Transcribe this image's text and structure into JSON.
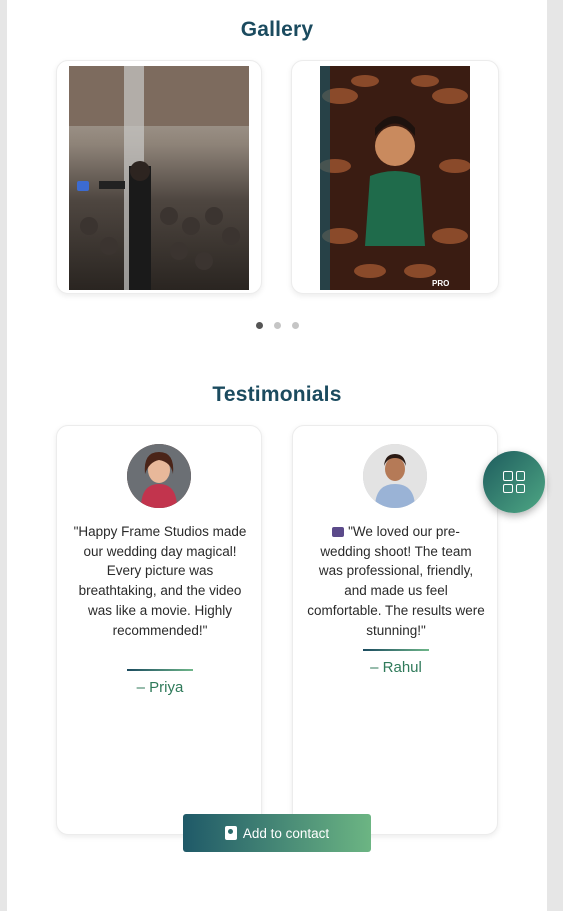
{
  "gallery": {
    "title": "Gallery",
    "images": [
      {
        "alt": "photographer filming audience"
      },
      {
        "alt": "bride with henna hands"
      }
    ],
    "dots": 3,
    "active_dot": 1
  },
  "testimonials": {
    "title": "Testimonials",
    "items": [
      {
        "quote": "\"Happy Frame Studios made our wedding day magical! Every picture was breathtaking, and the video was like a movie. Highly recommended!\"",
        "author": "– Priya"
      },
      {
        "quote": "\"We loved our pre-wedding shoot! The team was professional, friendly, and made us feel comfortable. The results were stunning!\"",
        "author": "– Rahul"
      }
    ]
  },
  "actions": {
    "add_contact_label": "Add to contact"
  },
  "colors": {
    "title": "#1b4b5f",
    "author": "#2f7a5a",
    "accent_start": "#1f5968",
    "accent_end": "#6cb583"
  }
}
